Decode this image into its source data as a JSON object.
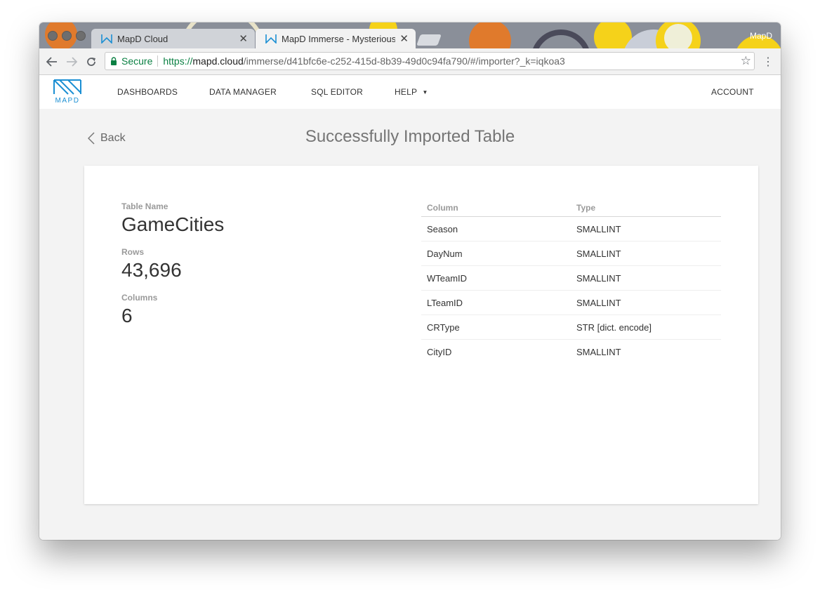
{
  "browser": {
    "tabs": [
      {
        "title": "MapD Cloud",
        "active": false
      },
      {
        "title": "MapD Immerse - Mysterious C",
        "active": true
      }
    ],
    "profile_name": "MapD",
    "secure_label": "Secure",
    "url": {
      "scheme": "https://",
      "host": "mapd.cloud",
      "path": "/immerse/d41bfc6e-c252-415d-8b39-49d0c94fa790/#/importer?_k=iqkoa3"
    },
    "icons": [
      "back-arrow-icon",
      "forward-arrow-icon",
      "reload-icon",
      "lock-icon",
      "star-icon",
      "menu-dots-icon"
    ]
  },
  "app": {
    "logo_text": "MAPD",
    "nav": {
      "dashboards": "DASHBOARDS",
      "data_manager": "DATA MANAGER",
      "sql_editor": "SQL EDITOR",
      "help": "HELP",
      "account": "ACCOUNT"
    },
    "back_label": "Back",
    "page_title": "Successfully Imported Table",
    "table": {
      "name_label": "Table Name",
      "name": "GameCities",
      "rows_label": "Rows",
      "rows": "43,696",
      "columns_label": "Columns",
      "columns": "6"
    },
    "schema": {
      "headers": {
        "column": "Column",
        "type": "Type"
      },
      "rows": [
        {
          "column": "Season",
          "type": "SMALLINT"
        },
        {
          "column": "DayNum",
          "type": "SMALLINT"
        },
        {
          "column": "WTeamID",
          "type": "SMALLINT"
        },
        {
          "column": "LTeamID",
          "type": "SMALLINT"
        },
        {
          "column": "CRType",
          "type": "STR [dict. encode]"
        },
        {
          "column": "CityID",
          "type": "SMALLINT"
        }
      ]
    }
  },
  "colors": {
    "brand_blue": "#1b8fd3",
    "secure_green": "#0b8043"
  }
}
